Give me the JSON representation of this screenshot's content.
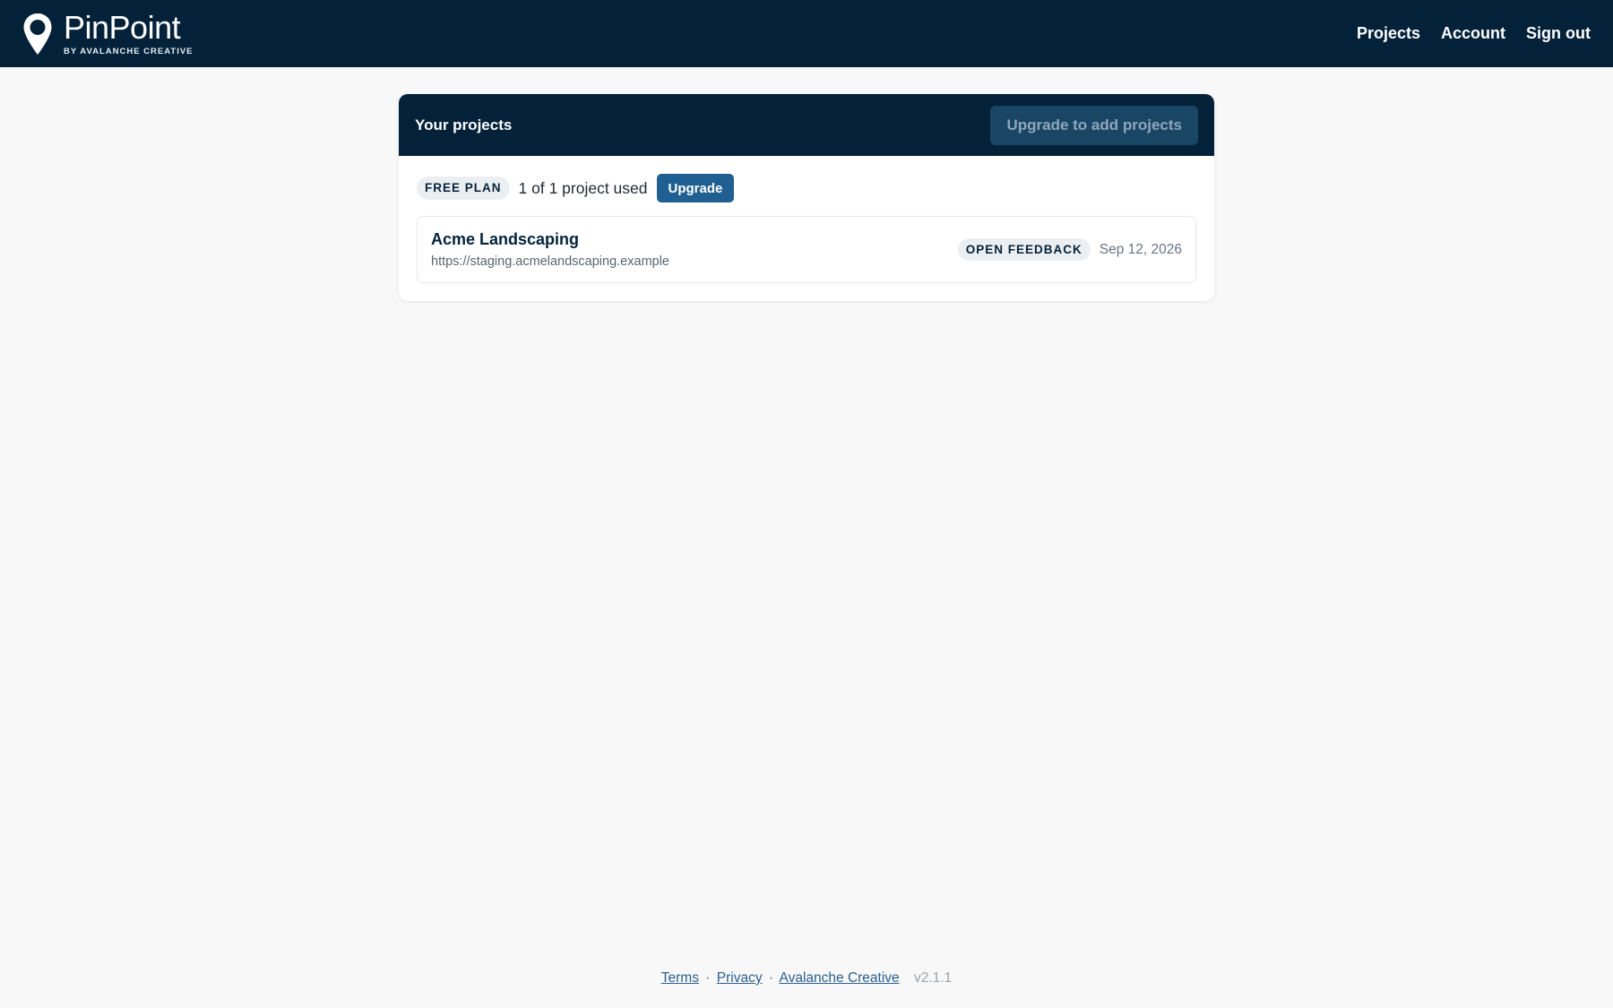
{
  "header": {
    "brand_name": "PinPoint",
    "brand_sub": "BY AVALANCHE CREATIVE",
    "logo_icon": "map-pin-icon",
    "nav": [
      {
        "label": "Projects"
      },
      {
        "label": "Account"
      },
      {
        "label": "Sign out"
      }
    ]
  },
  "projects_card": {
    "title": "Your projects",
    "add_button_label": "Upgrade to add projects",
    "plan": {
      "badge": "FREE PLAN",
      "usage": "1 of 1 project used",
      "upgrade_label": "Upgrade"
    },
    "projects": [
      {
        "name": "Acme Landscaping",
        "url": "https://staging.acmelandscaping.example",
        "status": "OPEN FEEDBACK",
        "date": "Sep 12, 2026"
      }
    ]
  },
  "footer": {
    "links": [
      {
        "label": "Terms"
      },
      {
        "label": "Privacy"
      },
      {
        "label": "Avalanche Creative"
      }
    ],
    "separator": "·",
    "version": "v2.1.1"
  },
  "colors": {
    "navy": "#03223a",
    "accent_blue": "#1f5f91",
    "page_bg": "#f8f8f8"
  }
}
